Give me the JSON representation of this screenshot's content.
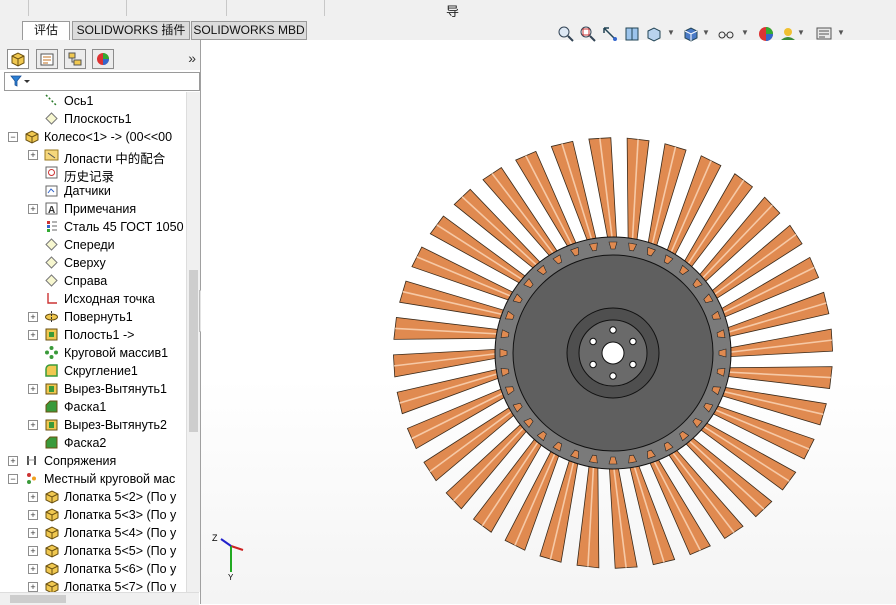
{
  "top_strip": {
    "label": "导"
  },
  "tabs": [
    {
      "label": "评估",
      "active": true
    },
    {
      "label": "SOLIDWORKS 插件",
      "active": false
    },
    {
      "label": "SOLIDWORKS MBD",
      "active": false
    }
  ],
  "panel_tabs": [
    {
      "icon": "feature-manager-icon",
      "active": true
    },
    {
      "icon": "property-manager-icon",
      "active": false
    },
    {
      "icon": "configuration-manager-icon",
      "active": false
    },
    {
      "icon": "display-manager-icon",
      "active": false
    }
  ],
  "panel_collapse": "»",
  "filter_icon": "filter-icon",
  "tree": [
    {
      "label": "Ось1",
      "icon": "axis-icon",
      "indent": 2,
      "expander": ""
    },
    {
      "label": "Плоскость1",
      "icon": "plane-icon",
      "indent": 2,
      "expander": ""
    },
    {
      "label": "Колесо<1> -> (00<<00",
      "icon": "part-icon",
      "indent": 1,
      "expander": "−"
    },
    {
      "label": "Лопасти 中的配合",
      "icon": "mates-folder-icon",
      "indent": 2,
      "expander": "+"
    },
    {
      "label": "历史记录",
      "icon": "history-icon",
      "indent": 2,
      "expander": ""
    },
    {
      "label": "Датчики",
      "icon": "sensors-icon",
      "indent": 2,
      "expander": ""
    },
    {
      "label": "Примечания",
      "icon": "annotations-icon",
      "indent": 2,
      "expander": "+"
    },
    {
      "label": "Сталь 45 ГОСТ 1050",
      "icon": "material-icon",
      "indent": 2,
      "expander": ""
    },
    {
      "label": "Спереди",
      "icon": "plane-icon",
      "indent": 2,
      "expander": ""
    },
    {
      "label": "Сверху",
      "icon": "plane-icon",
      "indent": 2,
      "expander": ""
    },
    {
      "label": "Справа",
      "icon": "plane-icon",
      "indent": 2,
      "expander": ""
    },
    {
      "label": "Исходная точка",
      "icon": "origin-icon",
      "indent": 2,
      "expander": ""
    },
    {
      "label": "Повернуть1",
      "icon": "revolve-icon",
      "indent": 2,
      "expander": "+"
    },
    {
      "label": "Полость1 ->",
      "icon": "cavity-icon",
      "indent": 2,
      "expander": "+"
    },
    {
      "label": "Круговой массив1",
      "icon": "circular-pattern-icon",
      "indent": 2,
      "expander": ""
    },
    {
      "label": "Скругление1",
      "icon": "fillet-icon",
      "indent": 2,
      "expander": ""
    },
    {
      "label": "Вырез-Вытянуть1",
      "icon": "cut-extrude-icon",
      "indent": 2,
      "expander": "+"
    },
    {
      "label": "Фаска1",
      "icon": "chamfer-icon",
      "indent": 2,
      "expander": ""
    },
    {
      "label": "Вырез-Вытянуть2",
      "icon": "cut-extrude-icon",
      "indent": 2,
      "expander": "+"
    },
    {
      "label": "Фаска2",
      "icon": "chamfer-icon",
      "indent": 2,
      "expander": ""
    },
    {
      "label": "Сопряжения",
      "icon": "mates-icon",
      "indent": 1,
      "expander": "+"
    },
    {
      "label": "Местный круговой мас",
      "icon": "local-pattern-icon",
      "indent": 1,
      "expander": "−"
    },
    {
      "label": "Лопатка 5<2> (По у",
      "icon": "part-icon",
      "indent": 2,
      "expander": "+"
    },
    {
      "label": "Лопатка 5<3> (По у",
      "icon": "part-icon",
      "indent": 2,
      "expander": "+"
    },
    {
      "label": "Лопатка 5<4> (По у",
      "icon": "part-icon",
      "indent": 2,
      "expander": "+"
    },
    {
      "label": "Лопатка 5<5> (По у",
      "icon": "part-icon",
      "indent": 2,
      "expander": "+"
    },
    {
      "label": "Лопатка 5<6> (По у",
      "icon": "part-icon",
      "indent": 2,
      "expander": "+"
    },
    {
      "label": "Лопатка 5<7> (По у",
      "icon": "part-icon",
      "indent": 2,
      "expander": "+"
    }
  ],
  "heads_up_toolbar": [
    "zoom-to-fit-icon",
    "zoom-to-area-icon",
    "previous-view-icon",
    "section-view-icon",
    "view-orientation-icon",
    "display-style-icon",
    "hide-show-items-icon",
    "edit-appearance-icon",
    "apply-scene-icon",
    "view-settings-icon"
  ],
  "triad": {
    "z_label": "Z",
    "y_label": "Y"
  },
  "model": {
    "blade_count": 36,
    "blade_color": "#e08a50",
    "hub_color": "#5f5f5f"
  }
}
